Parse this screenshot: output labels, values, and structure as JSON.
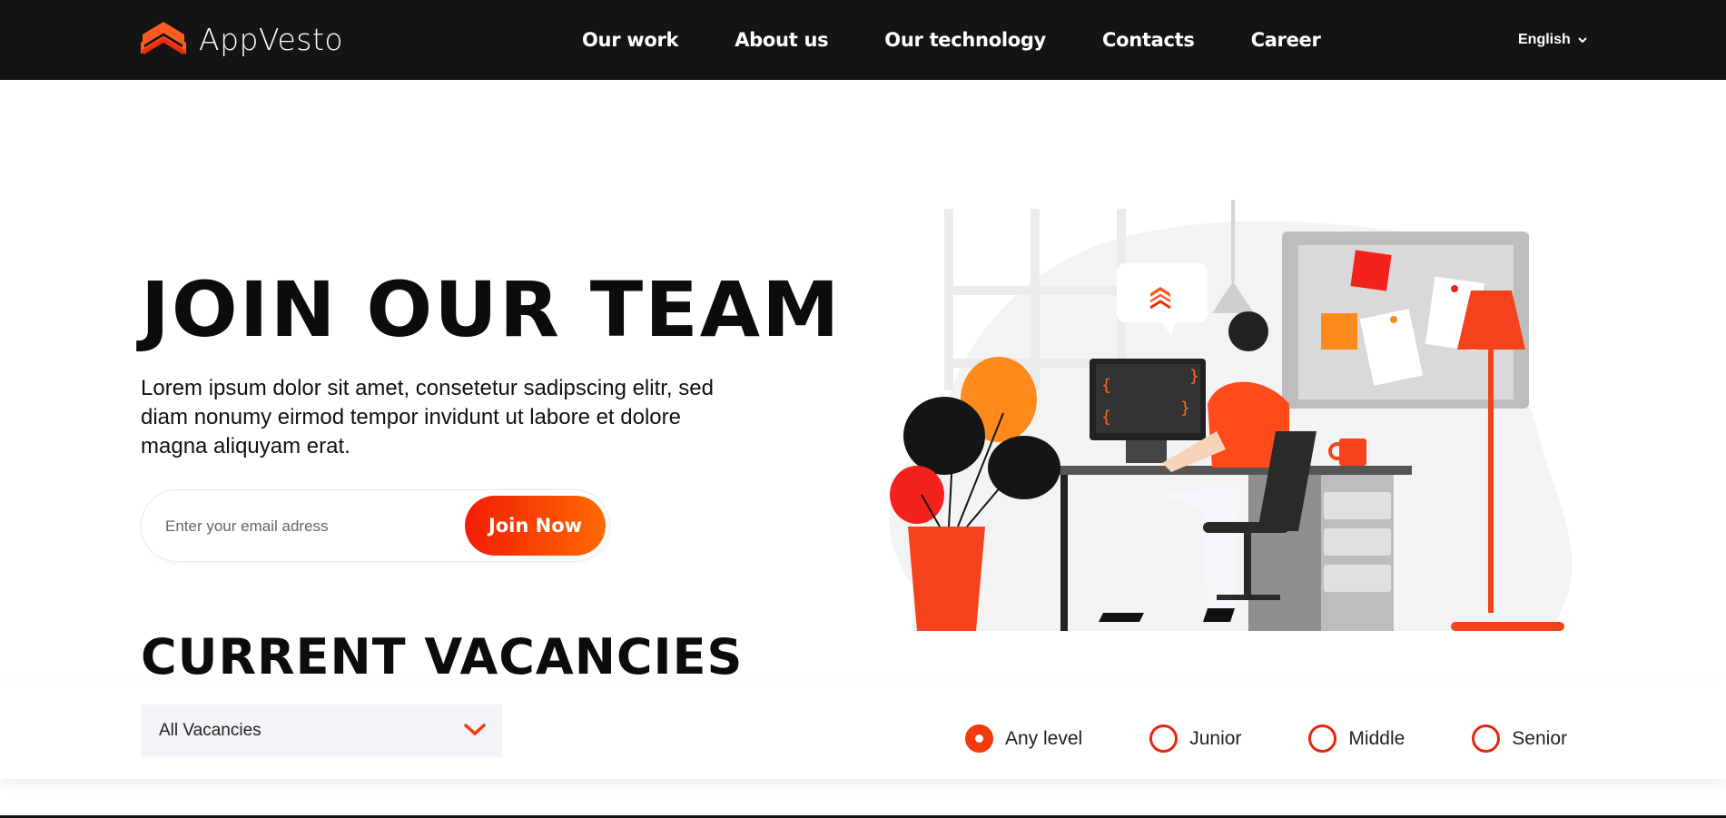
{
  "header": {
    "brand": "AppVesto",
    "nav": [
      {
        "label": "Our work"
      },
      {
        "label": "About us"
      },
      {
        "label": "Our technology"
      },
      {
        "label": "Contacts"
      },
      {
        "label": "Career"
      }
    ],
    "language": "English"
  },
  "hero": {
    "title": "JOIN OUR TEAM",
    "description": "Lorem ipsum dolor sit amet, consetetur sadipscing elitr, sed diam nonumy eirmod tempor invidunt ut labore et dolore magna aliquyam erat.",
    "email_placeholder": "Enter your email adress",
    "join_label": "Join Now"
  },
  "vacancies": {
    "title": "CURRENT VACANCIES",
    "select_value": "All Vacancies",
    "levels": [
      {
        "label": "Any level",
        "checked": true
      },
      {
        "label": "Junior",
        "checked": false
      },
      {
        "label": "Middle",
        "checked": false
      },
      {
        "label": "Senior",
        "checked": false
      }
    ]
  },
  "colors": {
    "accent": "#f33a0a",
    "accent_light": "#ff6a00",
    "header_bg": "#141414"
  },
  "icons": {
    "logo": "appvesto-chevrons-logo",
    "language_chevron": "chevron-down-icon",
    "select_chevron": "chevron-down-icon"
  }
}
